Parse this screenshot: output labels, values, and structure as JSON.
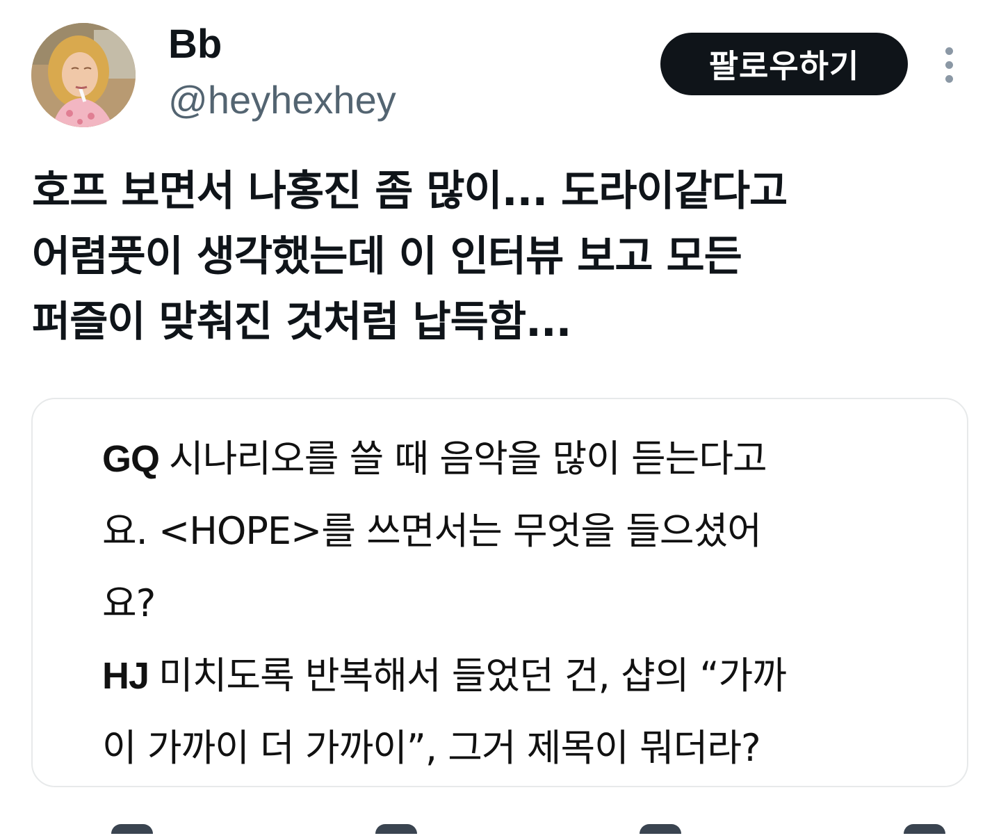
{
  "author": {
    "display_name": "Bb",
    "handle": "@heyhexhey",
    "avatar_icon": "profile-photo"
  },
  "actions": {
    "follow_label": "팔로우하기",
    "more_icon": "more-vertical-icon"
  },
  "tweet": {
    "text": "호프 보면서 나홍진 좀 많이... 도라이같다고\n어렴풋이 생각했는데 이 인터뷰 보고 모든\n퍼즐이 맞춰진 것처럼 납득함..."
  },
  "media_card": {
    "paragraphs": [
      {
        "speaker": "GQ",
        "text": "시나리오를 쓸 때 음악을 많이 듣는다고\n요. <HOPE>를 쓰면서는 무엇을 들으셨어\n요?"
      },
      {
        "speaker": "HJ",
        "text": "미치도록 반복해서 들었던 건, 샵의 “가까\n이 가까이 더 가까이”, 그거 제목이 뭐더라?"
      }
    ]
  },
  "colors": {
    "text_primary": "#0f1419",
    "text_secondary": "#536471",
    "follow_bg": "#0f1419",
    "border": "#e7e9ea"
  }
}
